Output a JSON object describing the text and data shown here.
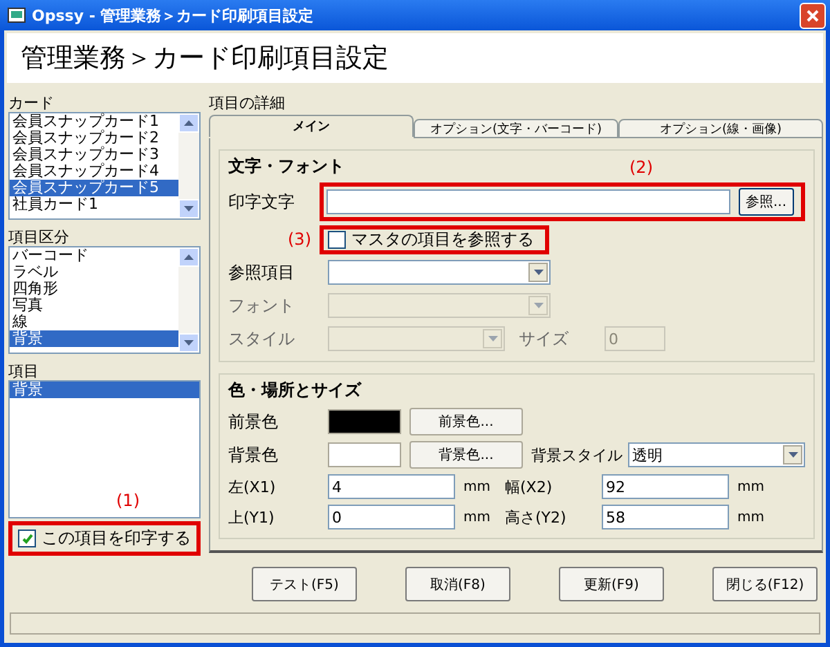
{
  "window": {
    "title": "Opssy - 管理業務＞カード印刷項目設定"
  },
  "header": "管理業務＞カード印刷項目設定",
  "lists": [
    {
      "label": "カード",
      "items": [
        {
          "text": "会員スナップカード1",
          "selected": false
        },
        {
          "text": "会員スナップカード2",
          "selected": false
        },
        {
          "text": "会員スナップカード3",
          "selected": false
        },
        {
          "text": "会員スナップカード4",
          "selected": false
        },
        {
          "text": "会員スナップカード5",
          "selected": true
        },
        {
          "text": "社員カード1",
          "selected": false
        }
      ]
    },
    {
      "label": "項目区分",
      "items": [
        {
          "text": "バーコード",
          "selected": false
        },
        {
          "text": "ラベル",
          "selected": false
        },
        {
          "text": "四角形",
          "selected": false
        },
        {
          "text": "写真",
          "selected": false
        },
        {
          "text": "線",
          "selected": false
        },
        {
          "text": "背景",
          "selected": true
        }
      ]
    },
    {
      "label": "項目",
      "items": [
        {
          "text": "背景",
          "selected": true
        }
      ]
    }
  ],
  "annotation_1": "(1)",
  "print_checkbox": {
    "label": "この項目を印字する",
    "checked": true
  },
  "details": {
    "label": "項目の詳細",
    "tabs": [
      {
        "label": "メイン",
        "selected": true
      },
      {
        "label": "オプション(文字・バーコード)",
        "selected": false
      },
      {
        "label": "オプション(線・画像)",
        "selected": false
      }
    ],
    "font_group": {
      "title": "文字・フォント",
      "annotation_2": "(2)",
      "annotation_3": "(3)",
      "print_text": {
        "label": "印字文字",
        "button": "参照..."
      },
      "master_checkbox": {
        "label": "マスタの項目を参照する",
        "checked": false
      },
      "ref_item": {
        "label": "参照項目",
        "disabled": false
      },
      "font": {
        "label": "フォント",
        "disabled": true
      },
      "style": {
        "label": "スタイル",
        "disabled": true
      },
      "size": {
        "label": "サイズ",
        "value": "0",
        "disabled": true
      }
    },
    "color_group": {
      "title": "色・場所とサイズ",
      "foreground": {
        "label": "前景色",
        "color": "#000000",
        "button": "前景色..."
      },
      "background": {
        "label": "背景色",
        "color": "#ffffff",
        "button": "背景色..."
      },
      "background_style": {
        "label": "背景スタイル",
        "value": "透明"
      },
      "positions": [
        {
          "label": "左(X1)",
          "value": "4",
          "unit": "mm"
        },
        {
          "label": "幅(X2)",
          "value": "92",
          "unit": "mm"
        },
        {
          "label": "上(Y1)",
          "value": "0",
          "unit": "mm"
        },
        {
          "label": "高さ(Y2)",
          "value": "58",
          "unit": "mm"
        }
      ]
    }
  },
  "buttons": [
    "テスト(F5)",
    "取消(F8)",
    "更新(F9)",
    "閉じる(F12)"
  ]
}
